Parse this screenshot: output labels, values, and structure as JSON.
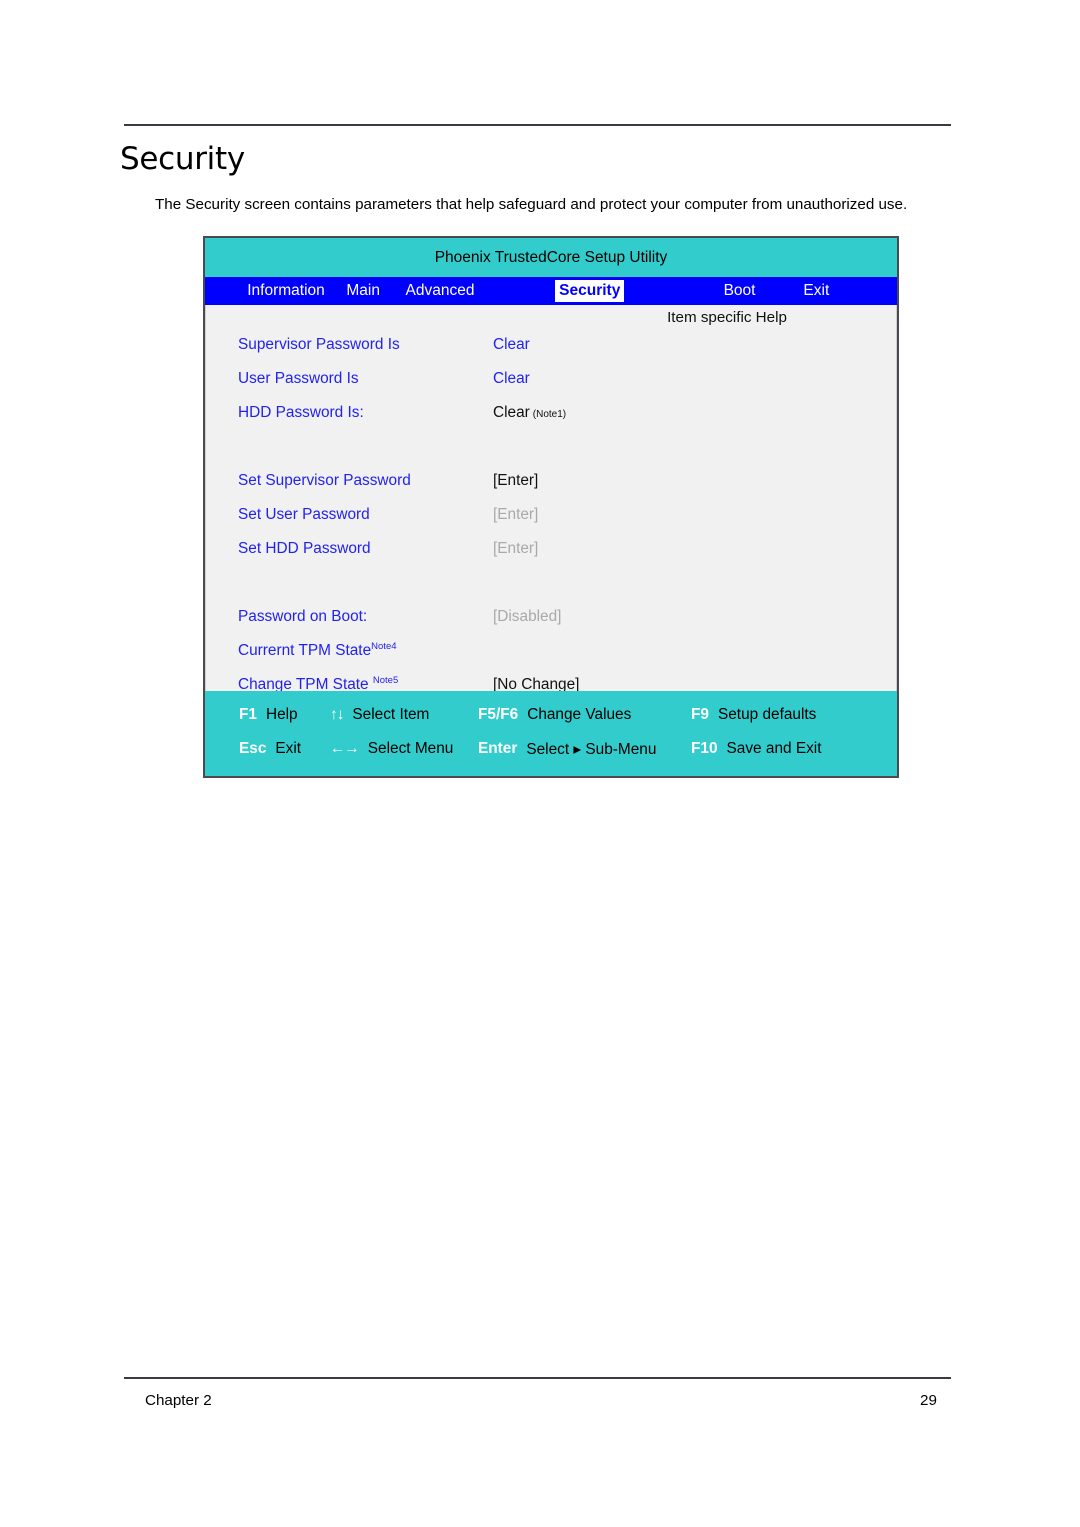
{
  "page": {
    "title": "Security",
    "intro": "The Security screen contains parameters that help safeguard and protect your computer from unauthorized use.",
    "footer_left": "Chapter 2",
    "footer_right": "29"
  },
  "colors": {
    "teal": "#32CCCC",
    "menu_blue": "#0000FF",
    "label_blue": "#2222EE",
    "disabled_gray": "#A9A9A9",
    "body_bg": "#F1F1F1"
  },
  "bios": {
    "utility_title": "Phoenix TrustedCore Setup Utility",
    "menu": [
      {
        "label": "Information",
        "selected": false
      },
      {
        "label": "Main",
        "selected": false
      },
      {
        "label": "Advanced",
        "selected": false
      },
      {
        "label": "Security",
        "selected": true
      },
      {
        "label": "Boot",
        "selected": false
      },
      {
        "label": "Exit",
        "selected": false
      }
    ],
    "help_header": "Item specific Help",
    "rows": [
      {
        "label": "Supervisor Password Is",
        "label_sup": "",
        "value": "Clear",
        "value_note": "",
        "state": "blue"
      },
      {
        "label": "User Password Is",
        "label_sup": "",
        "value": "Clear",
        "value_note": "",
        "state": "blue"
      },
      {
        "label": "HDD Password Is:",
        "label_sup": "",
        "value": "Clear",
        "value_note": "(Note1)",
        "state": "black"
      },
      {
        "label": "",
        "label_sup": "",
        "value": "",
        "value_note": "",
        "state": "spacer"
      },
      {
        "label": "Set Supervisor Password",
        "label_sup": "",
        "value": "[Enter]",
        "value_note": "",
        "state": "black"
      },
      {
        "label": "Set User Password",
        "label_sup": "",
        "value": "[Enter]",
        "value_note": "",
        "state": "gray"
      },
      {
        "label": "Set HDD Password",
        "label_sup": "",
        "value": "[Enter]",
        "value_note": "",
        "state": "gray"
      },
      {
        "label": "",
        "label_sup": "",
        "value": "",
        "value_note": "",
        "state": "spacer"
      },
      {
        "label": "Password on Boot:",
        "label_sup": "",
        "value": "[Disabled]",
        "value_note": "",
        "state": "gray"
      },
      {
        "label": "Currernt TPM State",
        "label_sup": "Note4",
        "value": "",
        "value_note": "",
        "state": "blue"
      },
      {
        "label": "Change TPM State ",
        "label_sup": "Note5",
        "value": "[No Change]",
        "value_note": "",
        "state": "black"
      }
    ],
    "keys": [
      [
        {
          "key": "F1",
          "glyph": "",
          "desc": "Help"
        },
        {
          "key": "",
          "glyph": "↑↓",
          "desc": "Select Item"
        },
        {
          "key": "F5/F6",
          "glyph": "",
          "desc": "Change Values"
        },
        {
          "key": "F9",
          "glyph": "",
          "desc": "Setup defaults"
        }
      ],
      [
        {
          "key": "Esc",
          "glyph": "",
          "desc": "Exit"
        },
        {
          "key": "",
          "glyph": "←→",
          "desc": "Select Menu"
        },
        {
          "key": "Enter",
          "glyph": "",
          "desc": "Select ▸ Sub-Menu"
        },
        {
          "key": "F10",
          "glyph": "",
          "desc": "Save and Exit"
        }
      ]
    ]
  }
}
